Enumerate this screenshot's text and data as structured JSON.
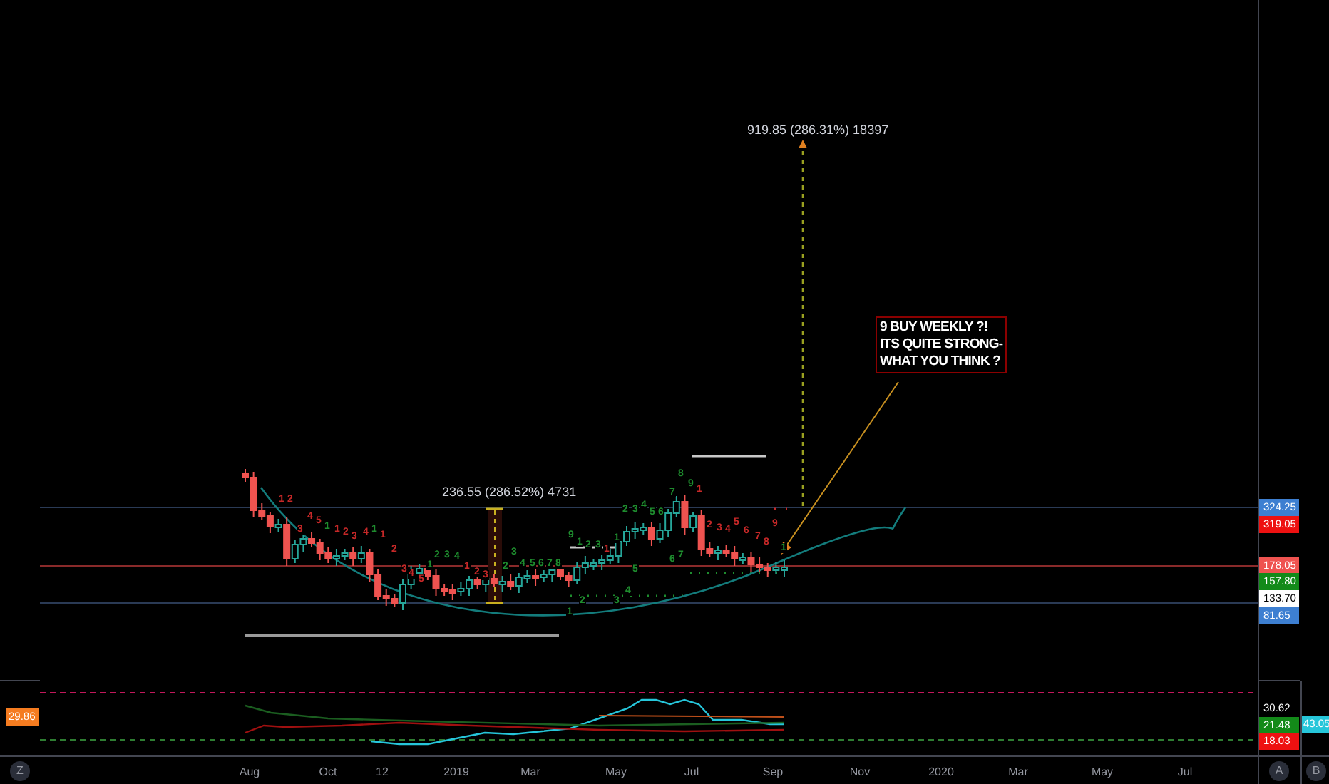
{
  "main_pane": {
    "measurements": [
      {
        "text": "919.85 (286.31%) 18397"
      },
      {
        "text": "236.55 (286.52%) 4731"
      }
    ],
    "annotation": {
      "lines": [
        "9 BUY WEEKLY ?!",
        "ITS QUITE STRONG-",
        "WHAT YOU THINK ?"
      ]
    },
    "setup_counts": [
      {
        "text": "1",
        "color": "#c62828"
      },
      {
        "text": "2",
        "color": "#c62828"
      },
      {
        "text": "3",
        "color": "#c62828"
      },
      {
        "text": "4",
        "color": "#c62828"
      },
      {
        "text": "5",
        "color": "#c62828"
      },
      {
        "text": "1",
        "color": "#1e8c2e"
      },
      {
        "text": "1",
        "color": "#c62828"
      },
      {
        "text": "2",
        "color": "#c62828"
      },
      {
        "text": "3",
        "color": "#c62828"
      },
      {
        "text": "4",
        "color": "#c62828"
      },
      {
        "text": "1",
        "color": "#1e8c2e"
      },
      {
        "text": "1",
        "color": "#c62828"
      },
      {
        "text": "2",
        "color": "#c62828"
      },
      {
        "text": "3",
        "color": "#c62828"
      },
      {
        "text": "4",
        "color": "#c62828"
      },
      {
        "text": "5",
        "color": "#c62828"
      },
      {
        "text": "1",
        "color": "#1e8c2e"
      },
      {
        "text": "2",
        "color": "#1e8c2e"
      },
      {
        "text": "3",
        "color": "#1e8c2e"
      },
      {
        "text": "4",
        "color": "#1e8c2e"
      },
      {
        "text": "1",
        "color": "#c62828"
      },
      {
        "text": "2",
        "color": "#c62828"
      },
      {
        "text": "3",
        "color": "#c62828"
      },
      {
        "text": "2",
        "color": "#1e8c2e"
      },
      {
        "text": "3",
        "color": "#1e8c2e"
      },
      {
        "text": "4",
        "color": "#1e8c2e"
      },
      {
        "text": "5",
        "color": "#1e8c2e"
      },
      {
        "text": "6",
        "color": "#1e8c2e"
      },
      {
        "text": "7",
        "color": "#1e8c2e"
      },
      {
        "text": "8",
        "color": "#1e8c2e"
      },
      {
        "text": "9",
        "color": "#1e8c2e"
      },
      {
        "text": "1",
        "color": "#1e8c2e"
      },
      {
        "text": "2",
        "color": "#1e8c2e"
      },
      {
        "text": "3",
        "color": "#1e8c2e"
      },
      {
        "text": "1",
        "color": "#c62828"
      },
      {
        "text": "1",
        "color": "#1e8c2e"
      },
      {
        "text": "2",
        "color": "#1e8c2e"
      },
      {
        "text": "3",
        "color": "#1e8c2e"
      },
      {
        "text": "4",
        "color": "#1e8c2e"
      },
      {
        "text": "5",
        "color": "#1e8c2e"
      },
      {
        "text": "6",
        "color": "#1e8c2e"
      },
      {
        "text": "7",
        "color": "#1e8c2e"
      },
      {
        "text": "8",
        "color": "#1e8c2e"
      },
      {
        "text": "9",
        "color": "#1e8c2e"
      },
      {
        "text": "1",
        "color": "#c62828"
      },
      {
        "text": "2",
        "color": "#c62828"
      },
      {
        "text": "3",
        "color": "#c62828"
      },
      {
        "text": "4",
        "color": "#c62828"
      },
      {
        "text": "5",
        "color": "#c62828"
      },
      {
        "text": "6",
        "color": "#c62828"
      },
      {
        "text": "7",
        "color": "#c62828"
      },
      {
        "text": "8",
        "color": "#c62828"
      },
      {
        "text": "9",
        "color": "#c62828"
      },
      {
        "text": "1",
        "color": "#1e8c2e"
      },
      {
        "text": "5",
        "color": "#1e8c2e"
      },
      {
        "text": "6",
        "color": "#1e8c2e"
      },
      {
        "text": "7",
        "color": "#1e8c2e"
      },
      {
        "text": "1",
        "color": "#1e8c2e"
      },
      {
        "text": "2",
        "color": "#1e8c2e"
      },
      {
        "text": "3",
        "color": "#1e8c2e"
      },
      {
        "text": "4",
        "color": "#1e8c2e"
      }
    ],
    "price_labels": [
      {
        "text": "324.25",
        "color": "#3d7fd1"
      },
      {
        "text": "319.05",
        "color": "#ee1111"
      },
      {
        "text": "178.05",
        "color": "#ef5350"
      },
      {
        "text": "157.80",
        "color": "#138a19"
      },
      {
        "text": "133.70",
        "color": "#ffffff"
      },
      {
        "text": "81.65",
        "color": "#3d7fd1"
      }
    ]
  },
  "indicator_pane": {
    "left_label": {
      "text": "29.86",
      "color": "#f57c20"
    },
    "price_labels": [
      {
        "text": "30.62",
        "color": "#000000"
      },
      {
        "text": "21.48",
        "color": "#138a19"
      },
      {
        "text": "18.03",
        "color": "#ee1111"
      }
    ],
    "right_label": {
      "text": "43.05",
      "color": "#26c6da"
    }
  },
  "time_axis": {
    "labels": [
      "Aug",
      "Oct",
      "12",
      "2019",
      "Mar",
      "May",
      "Jul",
      "Sep",
      "Nov",
      "2020",
      "Mar",
      "May",
      "Jul"
    ]
  },
  "corner_buttons": [
    "Z",
    "A",
    "B"
  ]
}
